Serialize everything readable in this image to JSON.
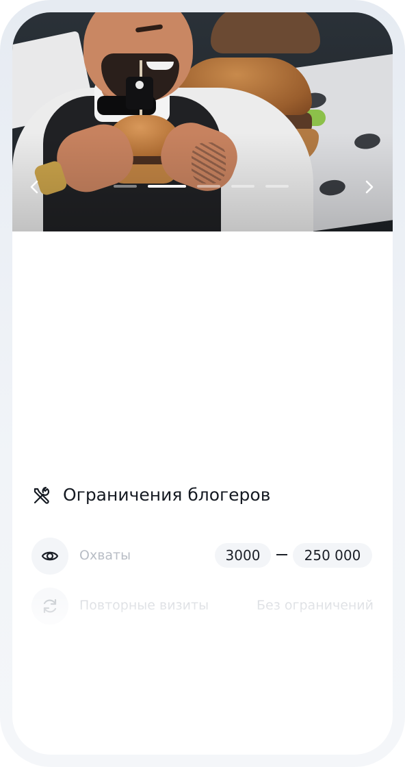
{
  "carousel": {
    "prev_icon": "chevron-left-icon",
    "next_icon": "chevron-right-icon",
    "slide_count": 5,
    "active_index": 1
  },
  "restrictions": {
    "title": "Ограничения блогеров",
    "title_icon": "tools-icon",
    "reach": {
      "label": "Охваты",
      "icon": "eye-icon",
      "min": "3000",
      "max": "250 000"
    },
    "repeat_visits": {
      "label": "Повторные визиты",
      "icon": "refresh-icon",
      "value": "Без ограничений"
    }
  },
  "colors": {
    "title_text": "#151a22",
    "muted_text": "#b8bdc5",
    "pill_background": "#f3f5f8",
    "frame": "#e6ebf2"
  }
}
